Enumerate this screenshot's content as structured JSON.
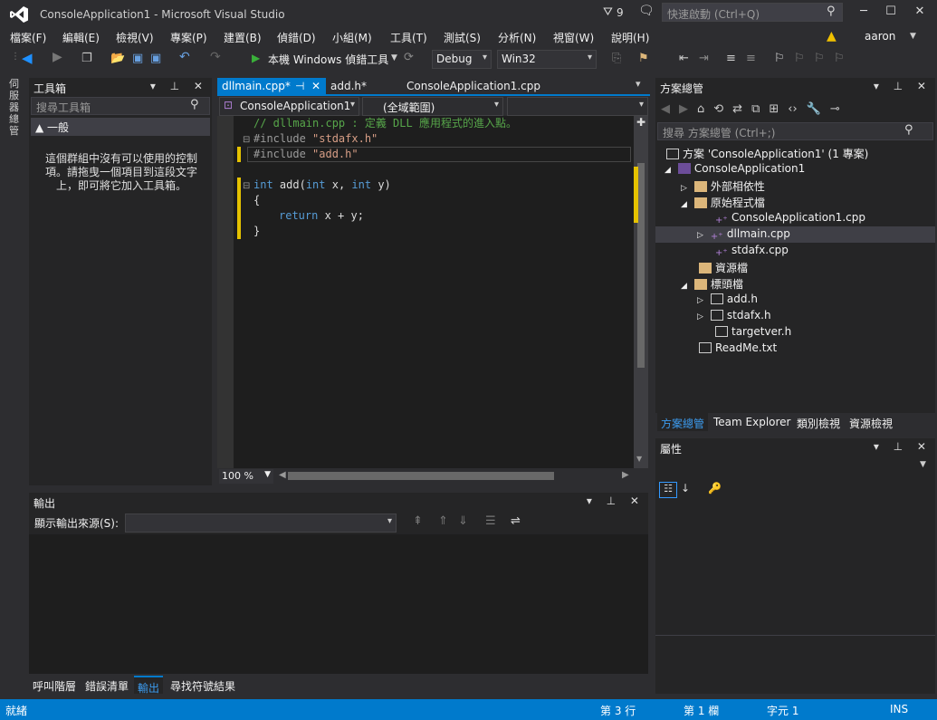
{
  "window": {
    "title": "ConsoleApplication1 - Microsoft Visual Studio",
    "notifications": "9",
    "quick_launch_placeholder": "快速啟動 (Ctrl+Q)",
    "user": "aaron"
  },
  "menu": [
    "檔案(F)",
    "編輯(E)",
    "檢視(V)",
    "專案(P)",
    "建置(B)",
    "偵錯(D)",
    "小組(M)",
    "工具(T)",
    "測試(S)",
    "分析(N)",
    "視窗(W)",
    "說明(H)"
  ],
  "toolbar": {
    "run_label": "本機 Windows 偵錯工具",
    "config": "Debug",
    "platform": "Win32"
  },
  "left_strip": {
    "label": "伺服器總管"
  },
  "toolbox": {
    "title": "工具箱",
    "search_placeholder": "搜尋工具箱",
    "group": "▲ 一般",
    "empty_message": "這個群組中沒有可以使用的控制項。請拖曳一個項目到這段文字上，即可將它加入工具箱。"
  },
  "editor": {
    "tabs": [
      {
        "label": "dllmain.cpp*"
      },
      {
        "label": "add.h*"
      },
      {
        "label": "ConsoleApplication1.cpp"
      }
    ],
    "project_combo": "ConsoleApplication1",
    "scope_combo": "(全域範圍)",
    "code": {
      "l1": "// dllmain.cpp : 定義 DLL 應用程式的進入點。",
      "l2_pp": "#include ",
      "l2_str": "\"stdafx.h\"",
      "l3_pp": "#include ",
      "l3_str": "\"add.h\"",
      "l5_kw": "int",
      "l5_rest": " add(",
      "l5_kw2": "int",
      "l5_x": " x, ",
      "l5_kw3": "int",
      "l5_y": " y)",
      "l6": "{",
      "l7_kw": "return",
      "l7_rest": " x + y;",
      "l8": "}"
    },
    "zoom": "100 %"
  },
  "output": {
    "title": "輸出",
    "source_label": "顯示輸出來源(S):",
    "bottom_tabs": [
      "呼叫階層",
      "錯誤清單",
      "輸出",
      "尋找符號結果"
    ]
  },
  "solution": {
    "title": "方案總管",
    "search_placeholder": "搜尋 方案總管 (Ctrl+;)",
    "items": [
      {
        "label": "方案 'ConsoleApplication1' (1 專案)"
      },
      {
        "label": "ConsoleApplication1"
      },
      {
        "label": "外部相依性"
      },
      {
        "label": "原始程式檔"
      },
      {
        "label": "ConsoleApplication1.cpp"
      },
      {
        "label": "dllmain.cpp"
      },
      {
        "label": "stdafx.cpp"
      },
      {
        "label": "資源檔"
      },
      {
        "label": "標頭檔"
      },
      {
        "label": "add.h"
      },
      {
        "label": "stdafx.h"
      },
      {
        "label": "targetver.h"
      },
      {
        "label": "ReadMe.txt"
      }
    ],
    "tabs": [
      "方案總管",
      "Team Explorer",
      "類別檢視",
      "資源檢視"
    ]
  },
  "properties": {
    "title": "屬性"
  },
  "status": {
    "ready": "就緒",
    "line": "第 3 行",
    "col": "第 1 欄",
    "char": "字元 1",
    "mode": "INS"
  },
  "colors": {
    "accent": "#007acc",
    "editor_bg": "#1e1e1e",
    "chrome": "#2d2d30"
  }
}
